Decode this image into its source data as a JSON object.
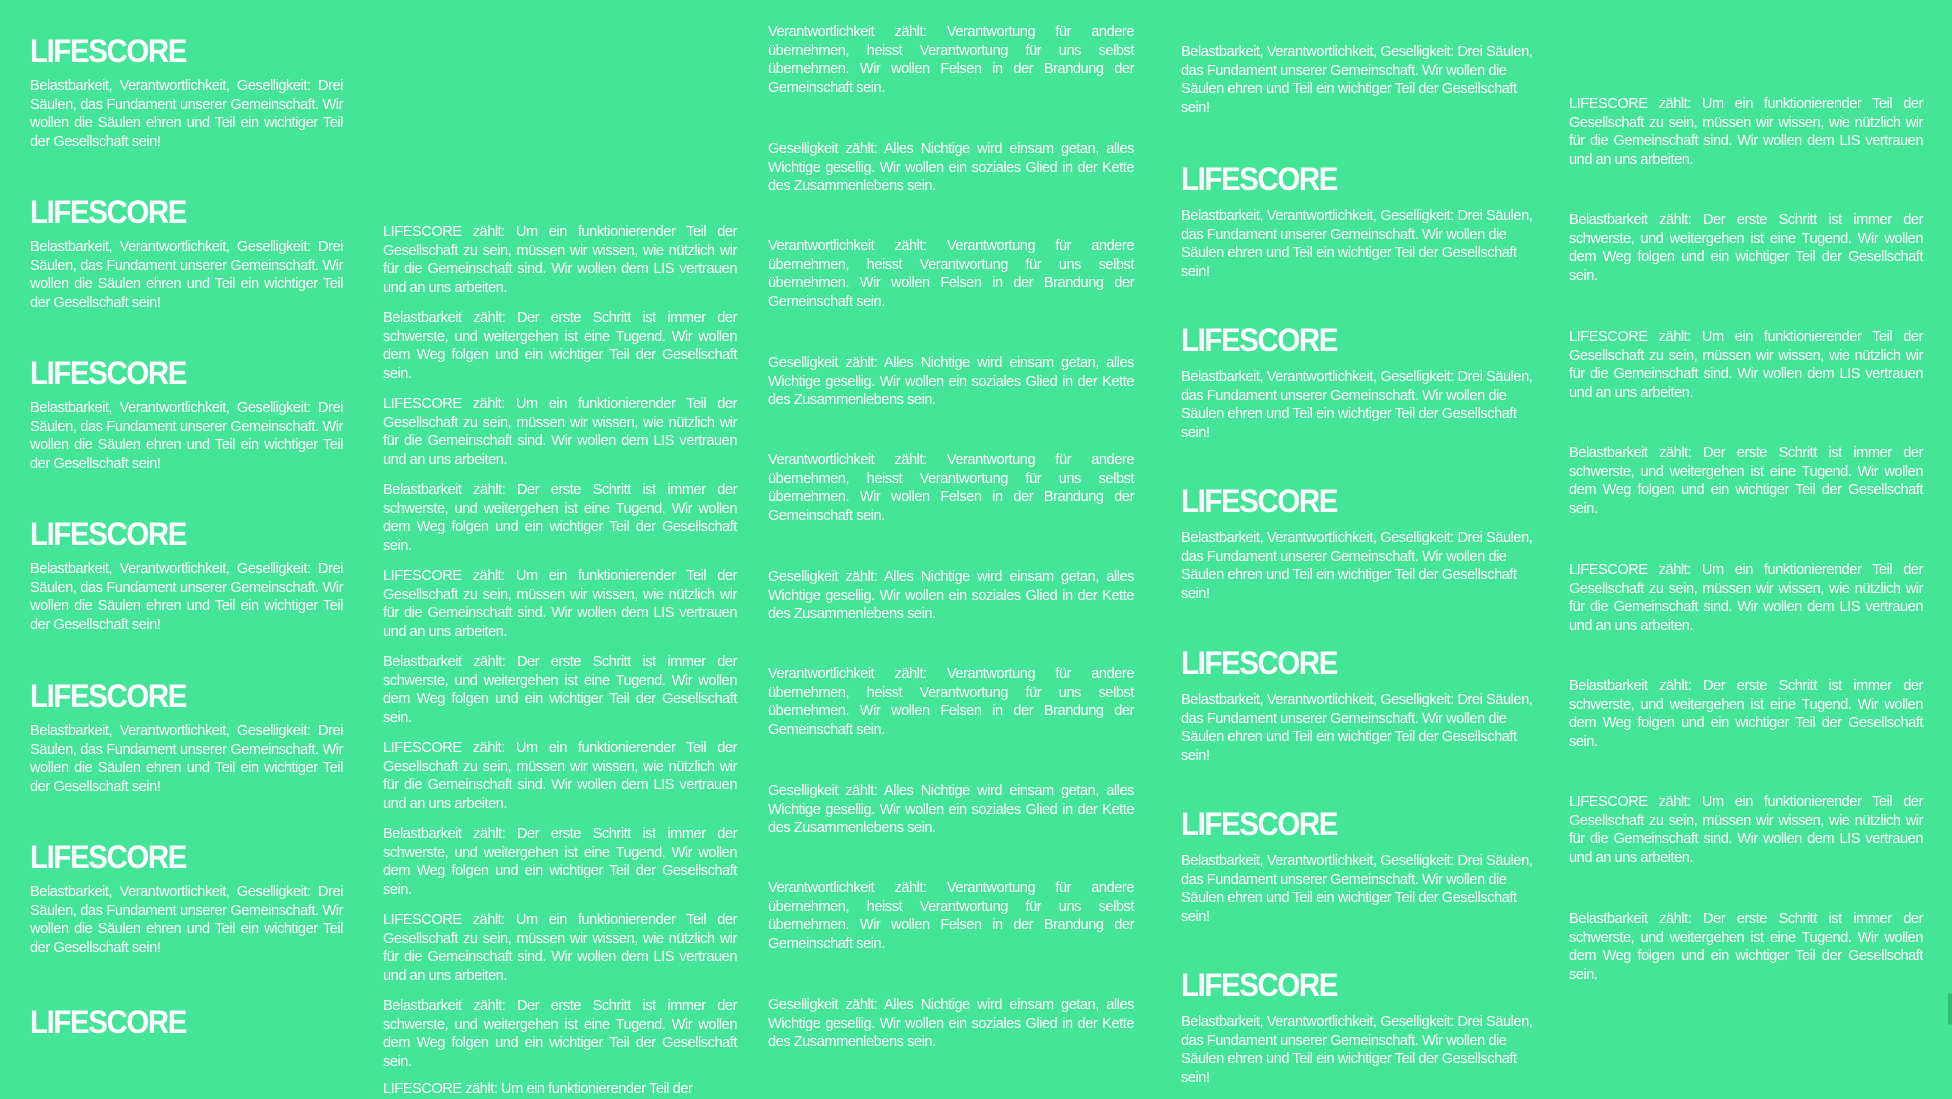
{
  "heading": "LIFESCORE",
  "text": {
    "pillars": "Belastbarkeit, Verantwortlichkeit, Geselligkeit: Drei Säulen, das Fundament unserer Gemeinschaft. Wir wollen die Säulen ehren und Teil ein wichtiger Teil der Gesellschaft sein!",
    "lifescore": "LIFESCORE zählt: Um ein funktionierender Teil der Gesellschaft zu sein, müssen wir wissen, wie nützlich wir für die Gemeinschaft sind. Wir wollen dem LIS vertrauen und an uns arbeiten.",
    "belastbarkeit": "Belastbarkeit zählt: Der erste Schritt ist immer der schwerste, und weitergehen ist eine Tugend. Wir wollen dem Weg folgen und ein wichtiger Teil der Gesellschaft sein.",
    "verantwortlichkeit": "Verantwortlichkeit zählt: Verantwortung für andere übernehmen, heisst Verantwortung für uns selbst übernehmen. Wir wollen Felsen in der Brandung der Gemeinschaft sein.",
    "geselligkeit": "Geselligkeit zählt: Alles Nichtige wird einsam getan, alles Wichtige gesellig. Wir wollen ein soziales Glied in der Kette des Zusammenlebens sein.",
    "partial": "LIFESCORE zählt: Um ein funktionierender Teil der"
  }
}
